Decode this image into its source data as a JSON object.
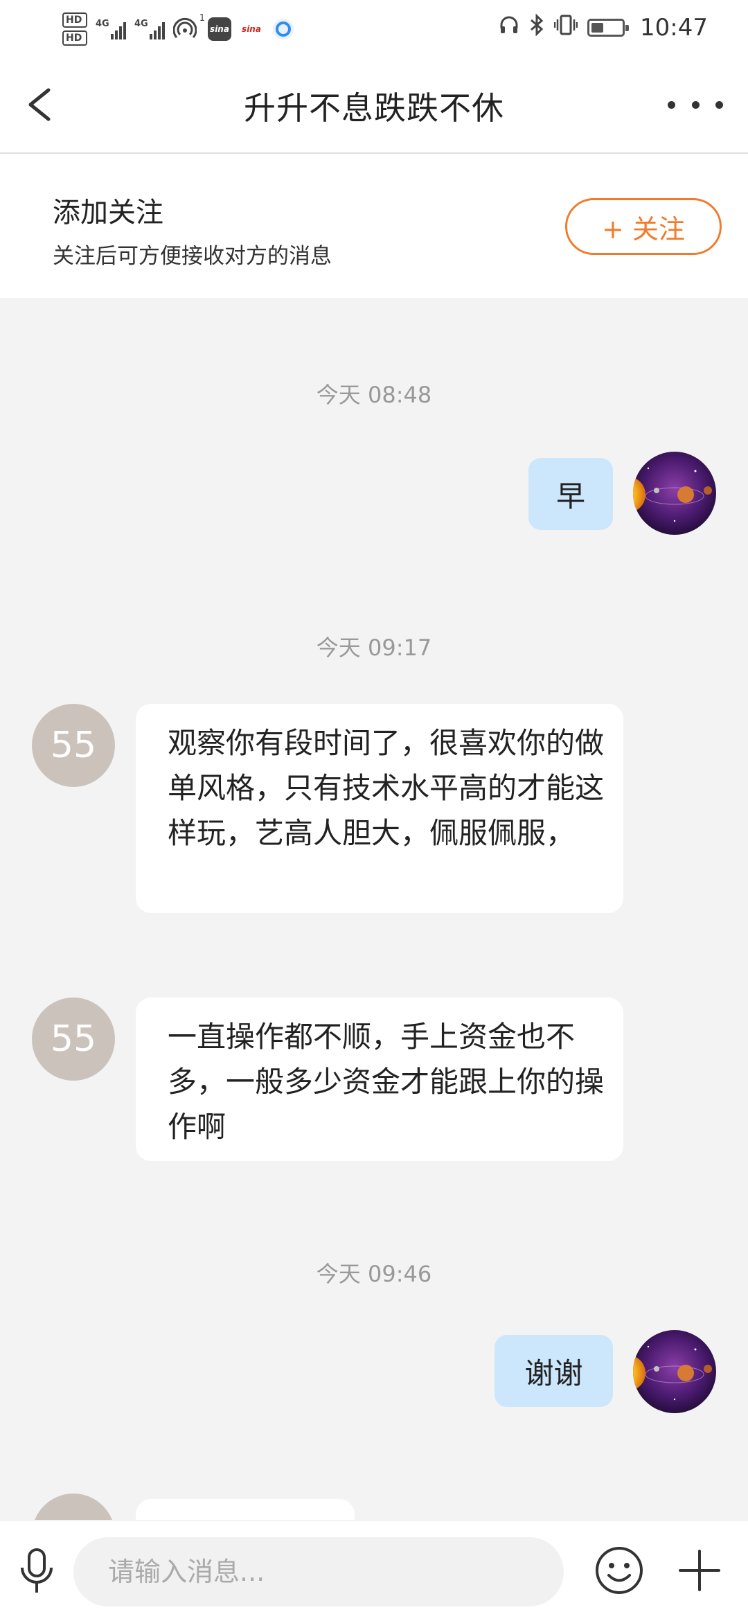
{
  "status_bar": {
    "hd1": "HD",
    "hd2": "HD",
    "net1": "4G",
    "net2": "4G",
    "hotspot_count": "1",
    "app1": "sina",
    "app2": "sina",
    "battery_level": 0.4,
    "time": "10:47"
  },
  "header": {
    "title": "升升不息跌跌不休"
  },
  "follow": {
    "title": "添加关注",
    "subtitle": "关注后可方便接收对方的消息",
    "button_label": "+ 关注"
  },
  "chat": {
    "messages": [
      {
        "time": "今天 08:48"
      },
      {
        "text": "早"
      },
      {
        "time": "今天 09:17"
      },
      {
        "avatar_text": "55",
        "text": "观察你有段时间了，很喜欢你的做单风格，只有技术水平高的才能这样玩，艺高人胆大，佩服佩服，"
      },
      {
        "avatar_text": "55",
        "text": "一直操作都不顺，手上资金也不多，一般多少资金才能跟上你的操作啊"
      },
      {
        "time": "今天 09:46"
      },
      {
        "text": "谢谢"
      }
    ]
  },
  "input_bar": {
    "placeholder": "请输入消息..."
  },
  "colors": {
    "accent": "#f07c2b",
    "outgoing_bubble": "#cce6fc",
    "incoming_bubble": "#ffffff",
    "chat_background": "#f3f3f3",
    "avatar_55": "#cbc2bc"
  },
  "icons": [
    "back-arrow-icon",
    "more-dots-icon",
    "microphone-icon",
    "emoji-icon",
    "plus-icon",
    "headphones-icon",
    "bluetooth-icon",
    "vibrate-icon",
    "battery-icon"
  ]
}
